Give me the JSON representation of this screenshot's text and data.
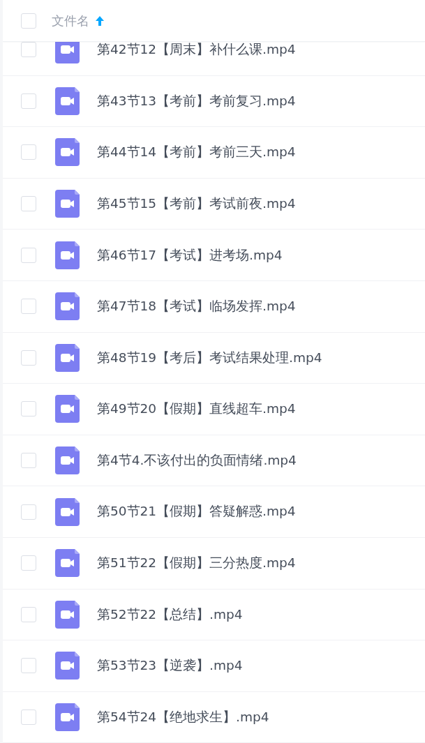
{
  "header": {
    "select_all": {
      "checked": false
    },
    "column": "文件名",
    "sorted_ascending": true
  },
  "files": [
    {
      "name": "第42节12【周末】补什么课.mp4",
      "checked": false
    },
    {
      "name": "第43节13【考前】考前复习.mp4",
      "checked": false
    },
    {
      "name": "第44节14【考前】考前三天.mp4",
      "checked": false
    },
    {
      "name": "第45节15【考前】考试前夜.mp4",
      "checked": false
    },
    {
      "name": "第46节17【考试】进考场.mp4",
      "checked": false
    },
    {
      "name": "第47节18【考试】临场发挥.mp4",
      "checked": false
    },
    {
      "name": "第48节19【考后】考试结果处理.mp4",
      "checked": false
    },
    {
      "name": "第49节20【假期】直线超车.mp4",
      "checked": false
    },
    {
      "name": "第4节4.不该付出的负面情绪.mp4",
      "checked": false
    },
    {
      "name": "第50节21【假期】答疑解惑.mp4",
      "checked": false
    },
    {
      "name": "第51节22【假期】三分热度.mp4",
      "checked": false
    },
    {
      "name": "第52节22【总结】.mp4",
      "checked": false
    },
    {
      "name": "第53节23【逆袭】.mp4",
      "checked": false
    },
    {
      "name": "第54节24【绝地求生】.mp4",
      "checked": false
    }
  ]
}
